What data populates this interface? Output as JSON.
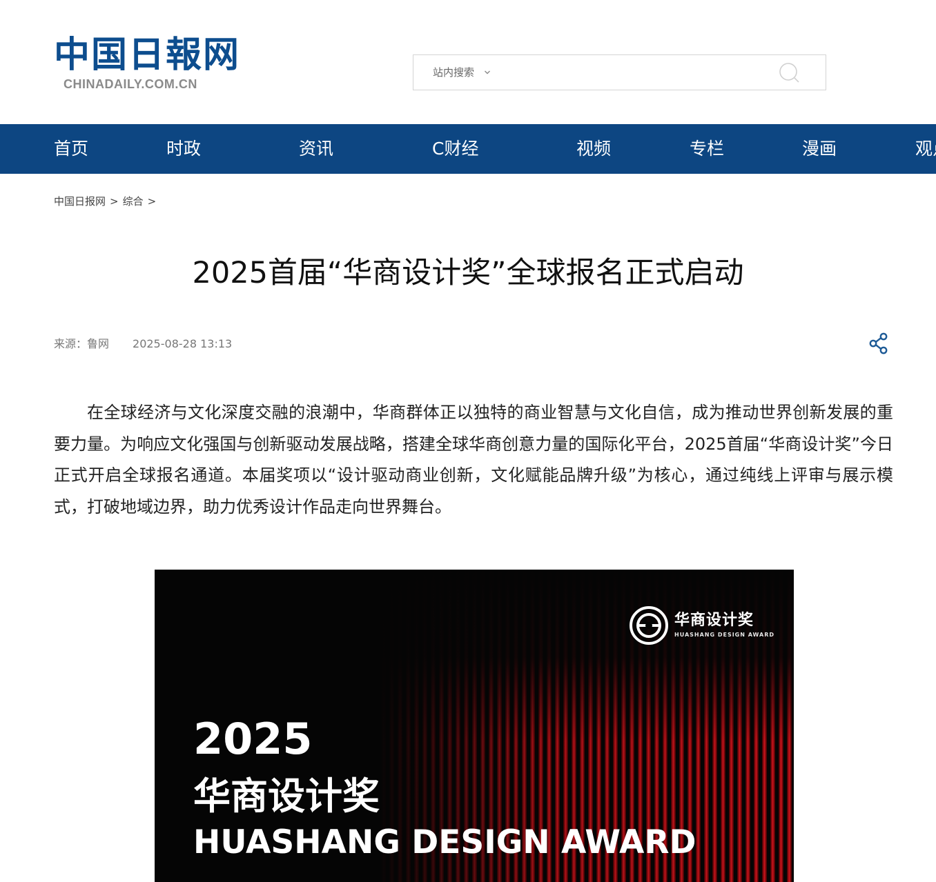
{
  "header": {
    "logo_cn": "中国日報网",
    "logo_en": "CHINADAILY.COM.CN",
    "search": {
      "scope_label": "站内搜索",
      "placeholder": ""
    }
  },
  "nav": {
    "items": [
      {
        "label": "首页"
      },
      {
        "label": "时政"
      },
      {
        "label": "资讯"
      },
      {
        "label": "C财经"
      },
      {
        "label": "视频"
      },
      {
        "label": "专栏"
      },
      {
        "label": "漫画"
      },
      {
        "label": "观点"
      }
    ]
  },
  "breadcrumb": {
    "items": [
      "中国日报网",
      "综合"
    ],
    "separator": ">"
  },
  "article": {
    "title": "2025首届“华商设计奖”全球报名正式启动",
    "source": "来源：鲁网",
    "datetime": "2025-08-28 13:13",
    "body": "在全球经济与文化深度交融的浪潮中，华商群体正以独特的商业智慧与文化自信，成为推动世界创新发展的重要力量。为响应文化强国与创新驱动发展战略，搭建全球华商创意力量的国际化平台，2025首届“华商设计奖”今日正式开启全球报名通道。本届奖项以“设计驱动商业创新，文化赋能品牌升级”为核心，通过纯线上评审与展示模式，打破地域边界，助力优秀设计作品走向世界舞台。"
  },
  "figure": {
    "logo_cn": "华商设计奖",
    "logo_en": "HUASHANG DESIGN AWARD",
    "year": "2025",
    "title_cn": "华商设计奖",
    "title_en": "HUASHANG DESIGN AWARD"
  },
  "colors": {
    "nav_bg": "#0d4682",
    "logo_blue": "#0d4d8e",
    "share_icon": "#1d5a96",
    "curtain_red": "#c8101a"
  },
  "icons": {
    "search": "search-icon",
    "share": "share-icon",
    "scope_dropdown": "chevron-down-icon"
  }
}
